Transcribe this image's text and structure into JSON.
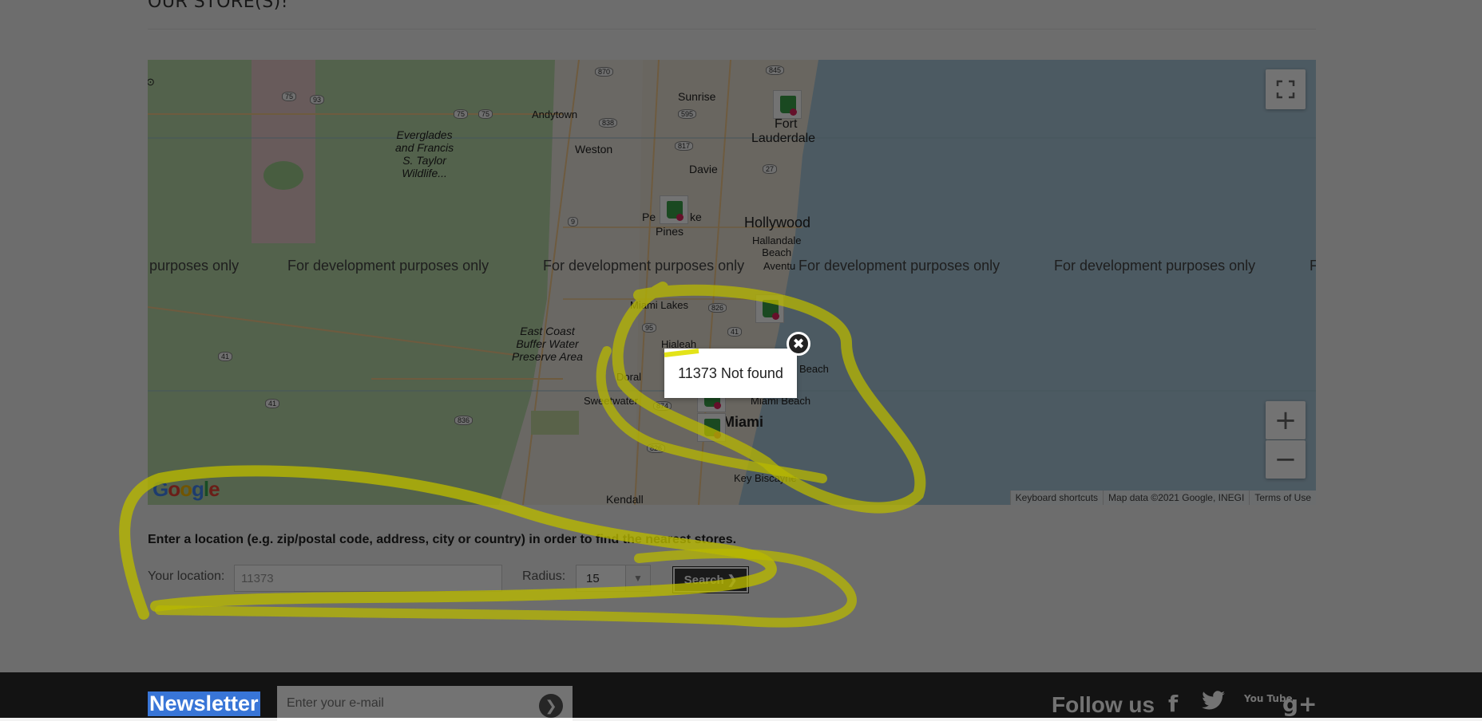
{
  "page": {
    "title": "OUR STORE(S)!"
  },
  "map": {
    "watermark": "For development purposes only",
    "watermark_cut_left": "purposes only",
    "watermark_cut_right": "F",
    "places": {
      "sunrise": "Sunrise",
      "fort": "Fort",
      "lauderdale": "Lauderdale",
      "weston": "Weston",
      "davie": "Davie",
      "andytown": "Andytown",
      "everglades": [
        "Everglades",
        "and Francis",
        "S. Taylor",
        "Wildlife..."
      ],
      "pembroke": "Pe",
      "pembroke2": "ke",
      "pines": "Pines",
      "hollywood": "Hollywood",
      "hallandale": [
        "Hallandale",
        "Beach"
      ],
      "aventura": "Aventu",
      "miami_lakes": "Miami Lakes",
      "east_coast": [
        "East Coast",
        "Buffer Water",
        "Preserve Area"
      ],
      "hialeah": "Hialeah",
      "doral": "Doral",
      "sweetwater": "Sweetwater",
      "miami": "Miami",
      "miami_beach": "Miami Beach",
      "beach": "Beach",
      "key_biscayne": "Key Biscayne",
      "kendall": "Kendall"
    },
    "shields": [
      "870",
      "845",
      "75",
      "93",
      "75",
      "75",
      "838",
      "595",
      "817",
      "27",
      "9",
      "826",
      "95",
      "41",
      "41",
      "41",
      "836",
      "874",
      "826"
    ],
    "fullscreen_icon": "fullscreen-icon",
    "zoom_in": "+",
    "zoom_out": "−",
    "logo": [
      "G",
      "o",
      "o",
      "g",
      "l",
      "e"
    ],
    "logo_colors": [
      "#4285f4",
      "#ea4335",
      "#fbbc05",
      "#4285f4",
      "#34a853",
      "#ea4335"
    ],
    "attribution": [
      "Keyboard shortcuts",
      "Map data ©2021 Google, INEGI",
      "Terms of Use"
    ]
  },
  "popup": {
    "message": "11373 Not found",
    "close_icon": "close-icon"
  },
  "form": {
    "instructions": "Enter a location (e.g. zip/postal code, address, city or country) in order to find the nearest stores.",
    "location_label": "Your location:",
    "location_value": "11373",
    "radius_label": "Radius:",
    "radius_value": "15",
    "search_label": "Search ❯"
  },
  "footer": {
    "newsletter_title": "Newsletter",
    "newsletter_placeholder": "Enter your e-mail",
    "follow_label": "Follow us",
    "social": [
      "f",
      "🐦",
      "You Tube",
      "g+"
    ]
  },
  "colors": {
    "highlight": "#d9d900",
    "dim": "rgba(0,0,0,0.55)",
    "accent": "#3875d7"
  }
}
